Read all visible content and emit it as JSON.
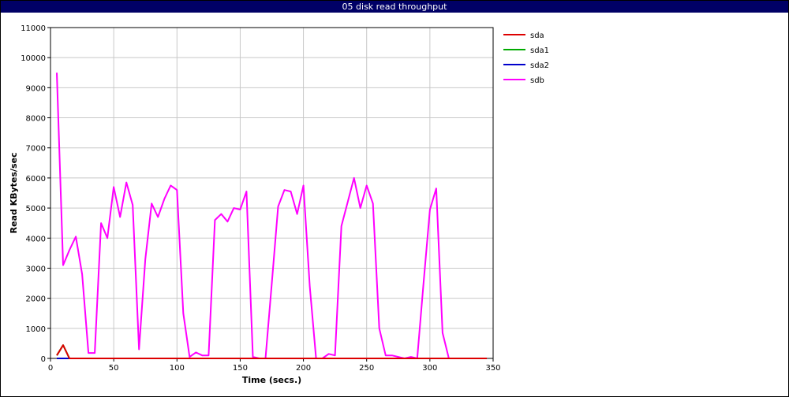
{
  "chart_data": {
    "type": "line",
    "title": "05 disk read throughput",
    "xlabel": "Time (secs.)",
    "ylabel": "Read KBytes/sec",
    "xlim": [
      0,
      350
    ],
    "ylim": [
      0,
      11000
    ],
    "x_ticks": [
      0,
      50,
      100,
      150,
      200,
      250,
      300,
      350
    ],
    "y_ticks": [
      0,
      1000,
      2000,
      3000,
      4000,
      5000,
      6000,
      7000,
      8000,
      9000,
      10000,
      11000
    ],
    "grid": true,
    "legend_position": "right",
    "series": [
      {
        "name": "sda",
        "color": "#dd0000",
        "x": [
          5,
          10,
          15,
          20,
          25,
          30,
          35,
          40,
          45,
          50,
          55,
          60,
          65,
          70,
          75,
          80,
          85,
          90,
          95,
          100,
          105,
          110,
          115,
          120,
          125,
          130,
          135,
          140,
          145,
          150,
          155,
          160,
          165,
          170,
          175,
          180,
          185,
          190,
          195,
          200,
          205,
          210,
          215,
          220,
          225,
          230,
          235,
          240,
          245,
          250,
          255,
          260,
          265,
          270,
          275,
          280,
          285,
          290,
          295,
          300,
          305,
          310,
          315,
          320,
          325,
          330,
          335,
          340,
          345
        ],
        "y": [
          100,
          440,
          0,
          0,
          0,
          0,
          0,
          0,
          0,
          0,
          0,
          0,
          0,
          0,
          0,
          0,
          0,
          0,
          0,
          0,
          0,
          0,
          0,
          0,
          0,
          0,
          0,
          0,
          0,
          0,
          0,
          0,
          0,
          0,
          0,
          0,
          0,
          0,
          0,
          0,
          0,
          0,
          0,
          0,
          0,
          0,
          0,
          0,
          0,
          0,
          0,
          0,
          0,
          0,
          0,
          0,
          0,
          0,
          0,
          0,
          0,
          0,
          0,
          0,
          0,
          0,
          0,
          0,
          0
        ]
      },
      {
        "name": "sda1",
        "color": "#00aa00",
        "x": [
          5,
          10,
          15,
          20,
          345
        ],
        "y": [
          100,
          440,
          0,
          0,
          0
        ]
      },
      {
        "name": "sda2",
        "color": "#0000cc",
        "x": [
          5,
          345
        ],
        "y": [
          0,
          0
        ]
      },
      {
        "name": "sdb",
        "color": "#ff00ff",
        "x": [
          5,
          10,
          15,
          20,
          25,
          30,
          35,
          40,
          45,
          50,
          55,
          60,
          65,
          70,
          75,
          80,
          85,
          90,
          95,
          100,
          105,
          110,
          115,
          120,
          125,
          130,
          135,
          140,
          145,
          150,
          155,
          160,
          165,
          170,
          175,
          180,
          185,
          190,
          195,
          200,
          205,
          210,
          215,
          220,
          225,
          230,
          235,
          240,
          245,
          250,
          255,
          260,
          265,
          270,
          275,
          280,
          285,
          290,
          295,
          300,
          305,
          310,
          315
        ],
        "y": [
          9500,
          3100,
          3600,
          4050,
          2800,
          180,
          180,
          4500,
          4000,
          5700,
          4700,
          5850,
          5100,
          300,
          3300,
          5150,
          4700,
          5300,
          5750,
          5600,
          1500,
          50,
          200,
          100,
          100,
          4600,
          4800,
          4550,
          5000,
          4950,
          5550,
          50,
          0,
          0,
          2500,
          5050,
          5600,
          5550,
          4800,
          5750,
          2400,
          0,
          0,
          150,
          100,
          4400,
          5200,
          6000,
          5000,
          5750,
          5150,
          1000,
          100,
          100,
          50,
          0,
          50,
          0,
          2500,
          4950,
          5650,
          850,
          0
        ]
      }
    ]
  }
}
